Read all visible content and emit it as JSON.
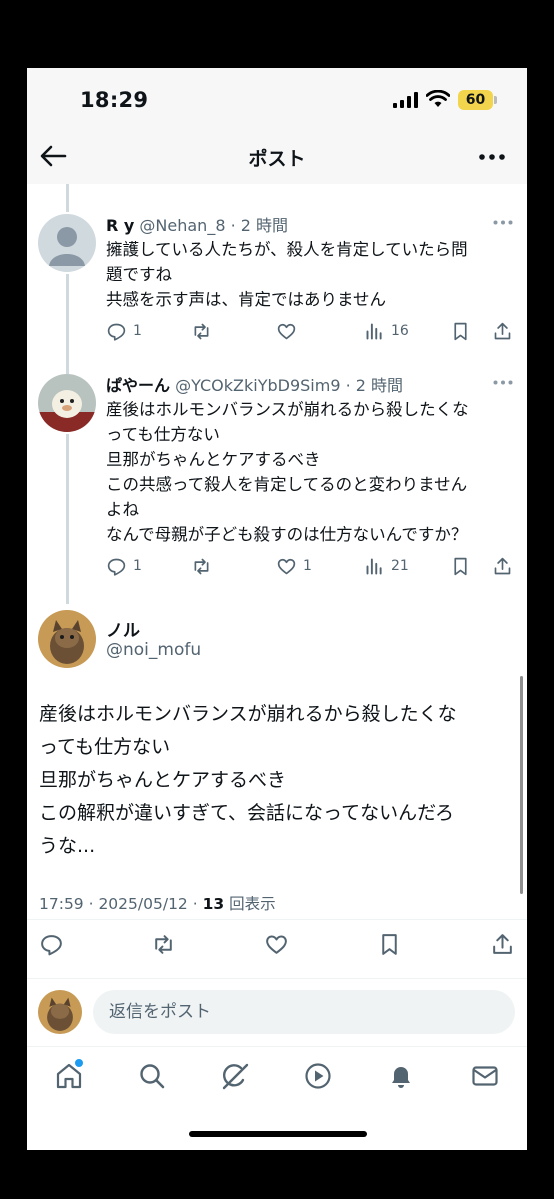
{
  "status_bar": {
    "time": "18:29",
    "battery": "60"
  },
  "header": {
    "title": "ポスト"
  },
  "replies": [
    {
      "name": "R y",
      "handle": "@Nehan_8",
      "time": "· 2 時間",
      "lines": [
        "擁護している人たちが、殺人を肯定していたら問",
        "題ですね",
        "共感を示す声は、肯定ではありません"
      ],
      "reply_count": "1",
      "retweet_count": "",
      "like_count": "",
      "views": "16"
    },
    {
      "name": "ぱやーん",
      "handle": "@YCOkZkiYbD9Sim9",
      "time": "· 2 時間",
      "lines": [
        "産後はホルモンバランスが崩れるから殺したくな",
        "っても仕方ない",
        "旦那がちゃんとケアするべき",
        "この共感って殺人を肯定してるのと変わりません",
        "よね",
        "なんで母親が子ども殺すのは仕方ないんですか？"
      ],
      "reply_count": "1",
      "retweet_count": "",
      "like_count": "1",
      "views": "21"
    }
  ],
  "main_post": {
    "name": "ノル",
    "handle": "@noi_mofu",
    "lines": [
      "産後はホルモンバランスが崩れるから殺したくな",
      "っても仕方ない",
      "旦那がちゃんとケアするべき",
      "この解釈が違いすぎて、会話になってないんだろ",
      "うな..."
    ],
    "timestamp": "17:59 · 2025/05/12 · ",
    "view_count": "13",
    "view_label": " 回表示"
  },
  "compose": {
    "placeholder": "返信をポスト"
  },
  "tabs": [
    "home-icon",
    "search-icon",
    "grok-icon",
    "video-icon",
    "notifications-icon",
    "messages-icon"
  ],
  "colors": {
    "accent": "#1d9bf0",
    "text": "#0f1419",
    "muted": "#536471",
    "battery": "#f2d54c"
  }
}
